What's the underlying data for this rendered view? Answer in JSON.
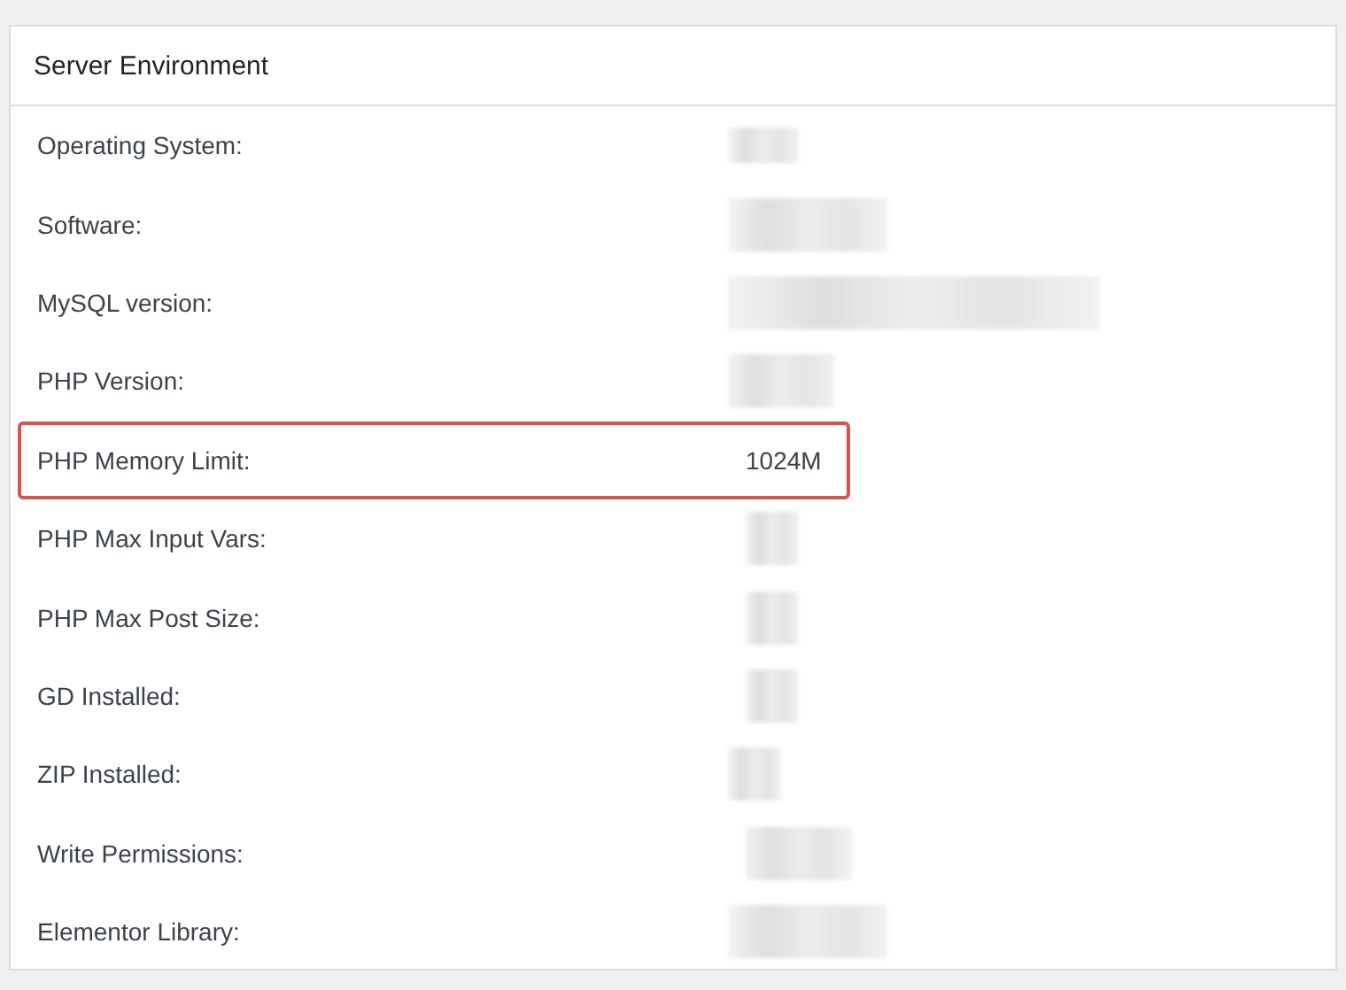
{
  "panel": {
    "title": "Server Environment"
  },
  "rows": [
    {
      "label": "Operating System:",
      "value_hidden": true,
      "highlighted": false
    },
    {
      "label": "Software:",
      "value_hidden": true,
      "highlighted": false
    },
    {
      "label": "MySQL version:",
      "value_hidden": true,
      "highlighted": false
    },
    {
      "label": "PHP Version:",
      "value_hidden": true,
      "highlighted": false
    },
    {
      "label": "PHP Memory Limit:",
      "value": "1024M",
      "value_hidden": false,
      "highlighted": true
    },
    {
      "label": "PHP Max Input Vars:",
      "value_hidden": true,
      "highlighted": false
    },
    {
      "label": "PHP Max Post Size:",
      "value_hidden": true,
      "highlighted": false
    },
    {
      "label": "GD Installed:",
      "value_hidden": true,
      "highlighted": false
    },
    {
      "label": "ZIP Installed:",
      "value_hidden": true,
      "highlighted": false
    },
    {
      "label": "Write Permissions:",
      "value_hidden": true,
      "highlighted": false
    },
    {
      "label": "Elementor Library:",
      "value_hidden": true,
      "highlighted": false
    }
  ]
}
